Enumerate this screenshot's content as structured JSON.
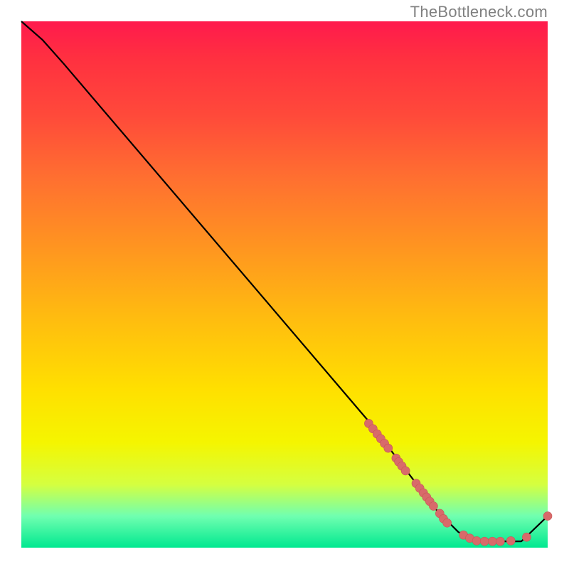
{
  "attribution": "TheBottleneck.com",
  "chart_data": {
    "type": "line",
    "title": "",
    "xlabel": "",
    "ylabel": "",
    "xlim": [
      0,
      100
    ],
    "ylim": [
      0,
      100
    ],
    "curve": [
      {
        "x": 0,
        "y": 100
      },
      {
        "x": 4,
        "y": 96.5
      },
      {
        "x": 8,
        "y": 92
      },
      {
        "x": 66,
        "y": 24
      },
      {
        "x": 79,
        "y": 7
      },
      {
        "x": 83,
        "y": 3
      },
      {
        "x": 86,
        "y": 1.2
      },
      {
        "x": 95,
        "y": 1.2
      },
      {
        "x": 100,
        "y": 6
      }
    ],
    "dot_clusters": [
      {
        "cx": 67,
        "cy": 22,
        "points": [
          {
            "x": 66.0,
            "y": 23.6
          },
          {
            "x": 66.8,
            "y": 22.6
          },
          {
            "x": 67.6,
            "y": 21.6
          },
          {
            "x": 68.3,
            "y": 20.7
          },
          {
            "x": 69.0,
            "y": 19.8
          },
          {
            "x": 69.7,
            "y": 18.9
          }
        ]
      },
      {
        "cx": 72.5,
        "cy": 15.5,
        "points": [
          {
            "x": 71.2,
            "y": 17.0
          },
          {
            "x": 71.7,
            "y": 16.3
          },
          {
            "x": 72.3,
            "y": 15.5
          },
          {
            "x": 73.0,
            "y": 14.6
          }
        ]
      },
      {
        "cx": 76.5,
        "cy": 10.5,
        "points": [
          {
            "x": 75.0,
            "y": 12.2
          },
          {
            "x": 75.7,
            "y": 11.3
          },
          {
            "x": 76.4,
            "y": 10.4
          },
          {
            "x": 77.0,
            "y": 9.6
          },
          {
            "x": 77.6,
            "y": 8.8
          },
          {
            "x": 78.3,
            "y": 7.9
          }
        ]
      },
      {
        "cx": 80.3,
        "cy": 5.5,
        "points": [
          {
            "x": 79.5,
            "y": 6.5
          },
          {
            "x": 80.2,
            "y": 5.5
          },
          {
            "x": 80.9,
            "y": 4.7
          }
        ]
      },
      {
        "cx": 89,
        "cy": 1.3,
        "points": [
          {
            "x": 84.0,
            "y": 2.4
          },
          {
            "x": 85.2,
            "y": 1.8
          },
          {
            "x": 86.5,
            "y": 1.3
          },
          {
            "x": 88.0,
            "y": 1.2
          },
          {
            "x": 89.5,
            "y": 1.2
          },
          {
            "x": 91.0,
            "y": 1.2
          },
          {
            "x": 93.0,
            "y": 1.3
          },
          {
            "x": 96.0,
            "y": 2.0
          }
        ]
      }
    ],
    "dot_radius": 6,
    "dot_color": "#d86a6a",
    "dot_stroke": "#c85555",
    "line_color": "#000000",
    "end_dot": {
      "x": 100,
      "y": 6
    }
  }
}
